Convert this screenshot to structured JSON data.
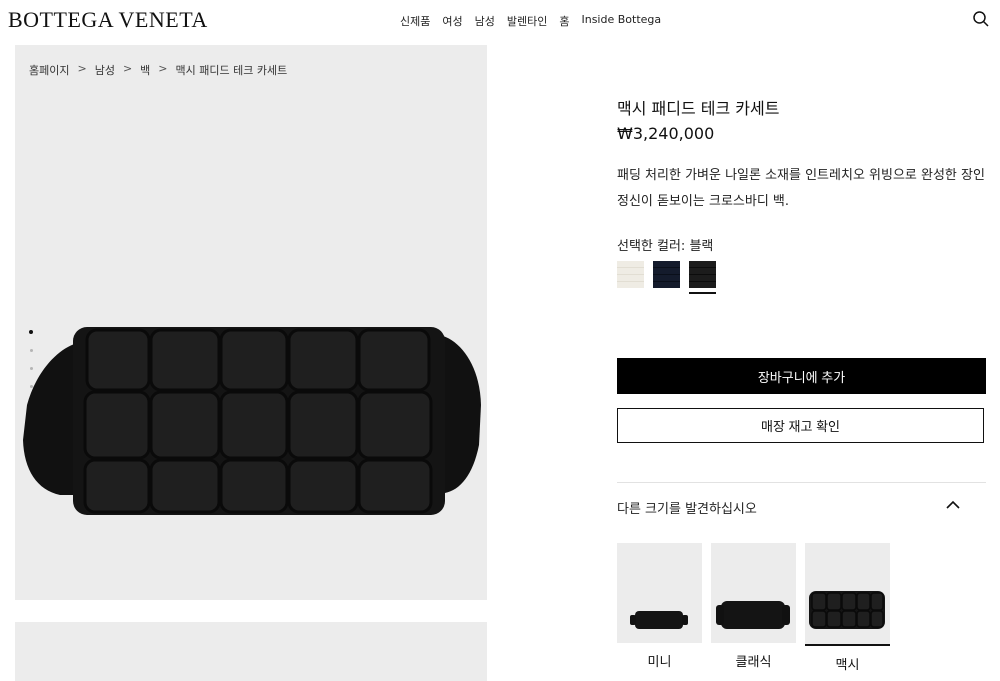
{
  "header": {
    "logo": "BOTTEGA VENETA",
    "nav": [
      "신제품",
      "여성",
      "남성",
      "발렌타인",
      "홈",
      "Inside Bottega"
    ]
  },
  "breadcrumb": [
    "홈페이지",
    "남성",
    "백",
    "맥시 패디드 테크 카세트"
  ],
  "breadcrumb_sep": ">",
  "gallery": {
    "slide_count": 4,
    "active_slide": 1
  },
  "product": {
    "title": "맥시 패디드 테크 카세트",
    "price": "₩3,240,000",
    "description": "패딩 처리한 가벼운 나일론 소재를 인트레치오 위빙으로 완성한 장인 정신이 돋보이는 크로스바디 백.",
    "color_label": "선택한 컬러: 블랙",
    "swatches": [
      {
        "color": "#efece4"
      },
      {
        "color": "#141b2c"
      },
      {
        "color": "#1c1c1c",
        "selected": true
      }
    ]
  },
  "actions": {
    "add_to_cart": "장바구니에 추가",
    "check_store": "매장 재고 확인"
  },
  "sizes": {
    "label": "다른 크기를 발견하십시오",
    "items": [
      {
        "name": "미니"
      },
      {
        "name": "클래식"
      },
      {
        "name": "맥시",
        "selected": true
      }
    ]
  },
  "icons": {
    "search": "search-icon",
    "chevron": "chevron-up-icon"
  },
  "colors": {
    "accent": "#000000",
    "panel_bg": "#ececec"
  }
}
